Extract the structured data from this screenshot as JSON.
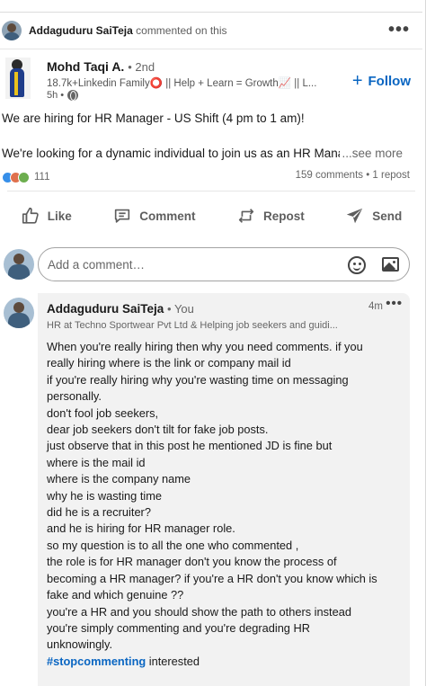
{
  "context": {
    "actor": "Addaguduru SaiTeja",
    "action": "commented on this",
    "more": "•••"
  },
  "post": {
    "author_name": "Mohd Taqi A.",
    "degree": "• 2nd",
    "headline": "18.7k+Linkedin Family⭕ || Help + Learn = Growth📈 || L...",
    "time": "5h •",
    "follow_label": "Follow",
    "line1": "We are hiring for HR Manager - US Shift (4 pm to 1 am)!",
    "line2": "We're looking for a dynamic individual to join us as an HR Manager",
    "see_more": "...see more",
    "reaction_count": "111",
    "comments_reposts": "159 comments • 1 repost"
  },
  "actions": {
    "like": "Like",
    "comment": "Comment",
    "repost": "Repost",
    "send": "Send"
  },
  "comment_box": {
    "placeholder": "Add a comment…"
  },
  "comment": {
    "author": "Addaguduru SaiTeja",
    "you_tag": "• You",
    "time": "4m",
    "dots": "•••",
    "headline": "HR at Techno Sportwear Pvt Ltd & Helping job seekers and guidi...",
    "lines": [
      "When you're really hiring then why you need comments. if you",
      "really hiring where is the link or company mail id",
      "if you're really hiring why you're wasting time on messaging",
      "personally.",
      "don't fool job seekers,",
      "dear job seekers don't tilt for fake job posts.",
      "just observe that in this post he mentioned JD is fine but",
      "where is the mail id",
      "where is the company name",
      "why he is wasting time",
      "did he is a recruiter?",
      "and he is hiring for HR manager role.",
      "so my question is to all the one who commented ,",
      "the role is for HR manager don't you know the process of",
      "becoming a HR manager? if you're a HR don't you know which is",
      "fake and which genuine ??",
      "you're a HR and you should show the path to others instead",
      "you're simply commenting and you're degrading HR",
      "unknowingly."
    ],
    "hashtag": "#stopcommenting",
    "last_word": "interested"
  },
  "colors": {
    "accent": "#0a66c2",
    "comment_bg": "#f2f2f2"
  }
}
